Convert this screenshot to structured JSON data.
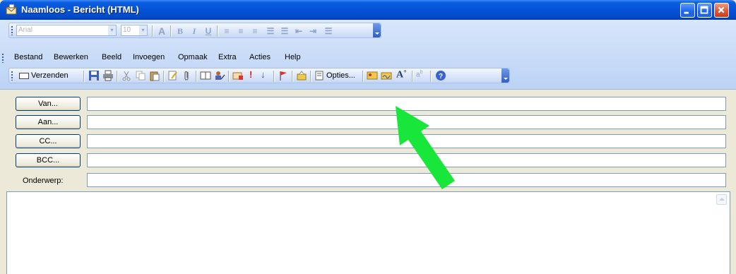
{
  "window": {
    "title": "Naamloos - Bericht (HTML)"
  },
  "format_toolbar": {
    "font": "Arial",
    "size": "10"
  },
  "menu": [
    "Bestand",
    "Bewerken",
    "Beeld",
    "Invoegen",
    "Opmaak",
    "Extra",
    "Acties",
    "Help"
  ],
  "standard_toolbar": {
    "send_label": "Verzenden",
    "options_label": "Opties..."
  },
  "form": {
    "from_button": "Van...",
    "to_button": "Aan...",
    "cc_button": "CC...",
    "bcc_button": "BCC...",
    "subject_label": "Onderwerp:"
  },
  "colors": {
    "titlebar": "#0553d6",
    "annotation_arrow": "#19e63a",
    "toolbar": "#c7d8f6"
  }
}
